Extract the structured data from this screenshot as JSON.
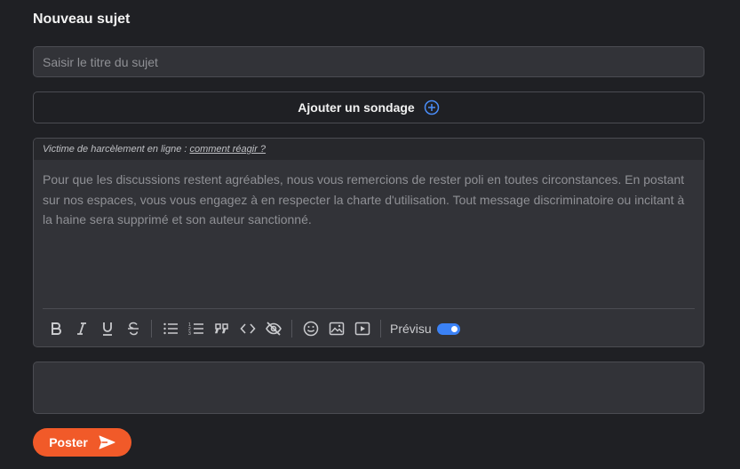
{
  "form": {
    "title": "Nouveau sujet",
    "subject_placeholder": "Saisir le titre du sujet",
    "poll_label": "Ajouter un sondage",
    "notice_text": "Victime de harcèlement en ligne :",
    "notice_link": "comment réagir ?",
    "body_placeholder": "Pour que les discussions restent agréables, nous vous remercions de rester poli en toutes circonstances. En postant sur nos espaces, vous vous engagez à en respecter la charte d'utilisation. Tout message discriminatoire ou incitant à la haine sera supprimé et son auteur sanctionné.",
    "preview_label": "Prévisu",
    "preview_enabled": true,
    "submit_label": "Poster"
  },
  "toolbar_icons": [
    "bold-icon",
    "italic-icon",
    "underline-icon",
    "strikethrough-icon",
    "bullet-list-icon",
    "numbered-list-icon",
    "quote-icon",
    "code-icon",
    "spoiler-icon",
    "emoji-icon",
    "image-icon",
    "video-icon"
  ],
  "colors": {
    "background": "#1f2024",
    "field": "#323338",
    "accent": "#3b82f6",
    "submit": "#f15a29"
  }
}
